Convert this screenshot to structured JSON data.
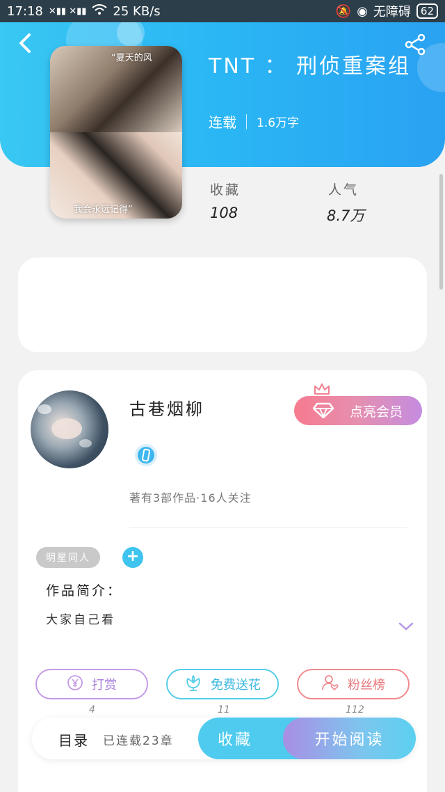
{
  "status_bar": {
    "time": "17:18",
    "network_speed": "25 KB/s",
    "carrier": "无障碍",
    "battery": "62"
  },
  "book": {
    "title": "TNT ： 刑侦重案组",
    "status": "连载",
    "word_count": "1.6万字",
    "cover_quote_top": "“夏天的风",
    "cover_quote_bottom": "我会永远记得”",
    "favorites_label": "收藏",
    "favorites_value": "108",
    "popularity_label": "人气",
    "popularity_value": "8.7万"
  },
  "author": {
    "name": "古巷烟柳",
    "stats": "著有3部作品·16人关注",
    "vip_button": "点亮会员"
  },
  "tags": [
    "明星同人"
  ],
  "intro": {
    "label": "作品简介：",
    "text": "大家自己看"
  },
  "actions": {
    "reward": {
      "label": "打赏",
      "count": "4"
    },
    "flower": {
      "label": "免费送花",
      "count": "11"
    },
    "fans": {
      "label": "粉丝榜",
      "count": "112"
    }
  },
  "bottom_bar": {
    "toc": "目录",
    "serial": "已连载23章",
    "collect": "收藏",
    "read": "开始阅读"
  },
  "icons": [
    "back-icon",
    "share-icon",
    "wifi-icon",
    "battery-icon",
    "crown-icon",
    "diamond-icon",
    "yen-icon",
    "flower-icon",
    "user-heart-icon",
    "plus-icon",
    "chevron-down-icon",
    "badge-icon"
  ],
  "colors": {
    "header_start": "#39c7f3",
    "header_end": "#2aa2f2",
    "vip_start": "#f77b8f",
    "vip_end": "#c48ce0",
    "reward": "#c59be6",
    "flower": "#55cde8",
    "fans": "#f08a8e"
  }
}
